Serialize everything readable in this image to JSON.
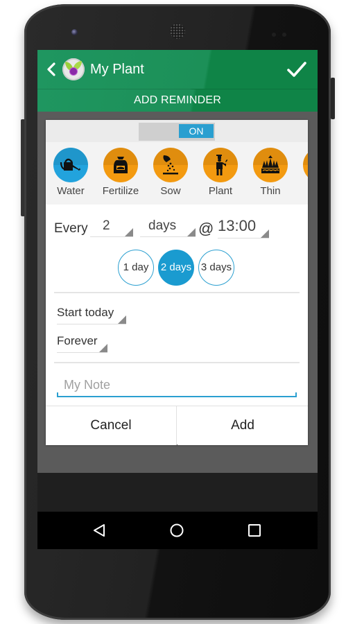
{
  "app": {
    "title": "My Plant",
    "screen_title": "ADD REMINDER",
    "back_icon": "chevron-left-icon",
    "confirm_icon": "checkmark-icon",
    "logo_icon": "plant-clock-logo-icon"
  },
  "toggle": {
    "state_label": "ON",
    "on": true
  },
  "reminder_types": [
    {
      "label": "Water",
      "icon": "watering-can-icon",
      "color": "#22a3dd",
      "selected": true
    },
    {
      "label": "Fertilize",
      "icon": "fertilizer-bag-icon",
      "color": "#f39a10",
      "selected": false
    },
    {
      "label": "Sow",
      "icon": "sow-seeds-icon",
      "color": "#f39a10",
      "selected": false
    },
    {
      "label": "Plant",
      "icon": "gardener-icon",
      "color": "#f39a10",
      "selected": false
    },
    {
      "label": "Thin",
      "icon": "thin-plants-icon",
      "color": "#f39a10",
      "selected": false
    },
    {
      "label": "",
      "icon": "more-type-icon",
      "color": "#f39a10",
      "selected": false
    }
  ],
  "schedule": {
    "every_label": "Every",
    "interval_value": "2",
    "interval_unit": "days",
    "at_symbol": "@",
    "time": "13:00",
    "quick_picks": [
      {
        "label": "1 day",
        "selected": false
      },
      {
        "label": "2 days",
        "selected": true
      },
      {
        "label": "3 days",
        "selected": false
      }
    ]
  },
  "range": {
    "start": "Start today",
    "end": "Forever"
  },
  "note": {
    "placeholder": "My Note",
    "value": ""
  },
  "buttons": {
    "cancel": "Cancel",
    "add": "Add"
  },
  "nav": {
    "back": "nav-back-icon",
    "home": "nav-home-icon",
    "recents": "nav-recents-icon"
  },
  "colors": {
    "primary_green": "#1c9058",
    "accent_blue": "#1a9bd0",
    "type_orange": "#f39a10"
  }
}
